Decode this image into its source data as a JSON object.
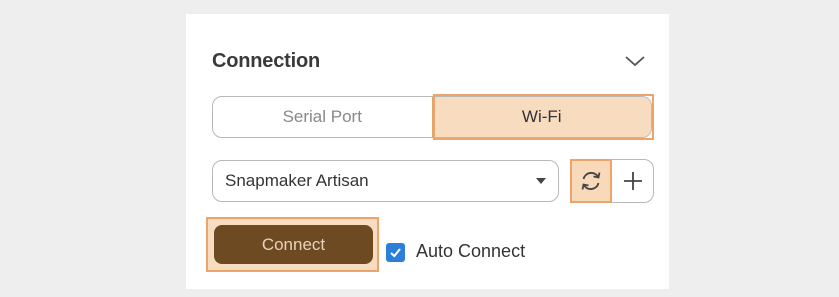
{
  "panel": {
    "title": "Connection",
    "collapse_icon": "chevron-down-icon"
  },
  "tabs": [
    {
      "label": "Serial Port",
      "active": false
    },
    {
      "label": "Wi-Fi",
      "active": true
    }
  ],
  "device_select": {
    "value": "Snapmaker Artisan",
    "icon": "caret-down-icon"
  },
  "actions": {
    "refresh_icon": "refresh-icon",
    "add_icon": "plus-icon"
  },
  "connect": {
    "label": "Connect"
  },
  "auto_connect": {
    "label": "Auto Connect",
    "checked": true
  },
  "colors": {
    "highlight_fill": "#f8dcbf",
    "highlight_border": "#eca46a",
    "connect_button": "#6e4a22",
    "checkbox": "#2b7fd9"
  }
}
